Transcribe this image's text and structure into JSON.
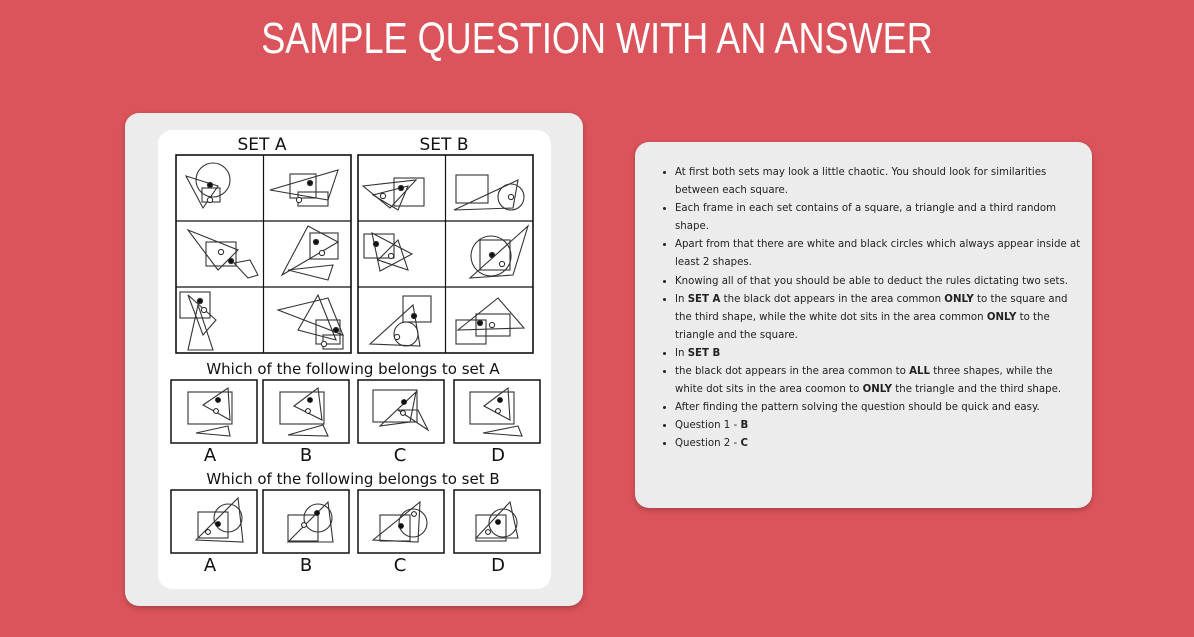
{
  "page": {
    "title": "SAMPLE QUESTION WITH AN ANSWER"
  },
  "figure": {
    "set_a_label": "SET A",
    "set_b_label": "SET B",
    "question_1": "Which of the following belongs to set A",
    "question_2": "Which of the following belongs to set B",
    "options_1": [
      "A",
      "B",
      "C",
      "D"
    ],
    "options_2": [
      "A",
      "B",
      "C",
      "D"
    ]
  },
  "answer": {
    "items": [
      [
        {
          "t": "At first both sets may look a little chaotic. You should look for similarities between each square."
        }
      ],
      [
        {
          "t": "Each frame in each set contains of a square, a triangle and a third random shape."
        }
      ],
      [
        {
          "t": "Apart from that there are white and black circles which always appear inside at least 2 shapes."
        }
      ],
      [
        {
          "t": "Knowing all of that you should be able to deduct the rules dictating two sets."
        }
      ],
      [
        {
          "t": "In "
        },
        {
          "t": "SET A",
          "b": true
        },
        {
          "t": " the black dot appears in the area common "
        },
        {
          "t": "ONLY",
          "b": true
        },
        {
          "t": " to the square and the third shape, while the white dot sits in the area common "
        },
        {
          "t": "ONLY",
          "b": true
        },
        {
          "t": " to the triangle and the square."
        }
      ],
      [
        {
          "t": "In "
        },
        {
          "t": "SET B",
          "b": true
        }
      ],
      [
        {
          "t": "the black dot appears in the area common to "
        },
        {
          "t": "ALL",
          "b": true
        },
        {
          "t": " three shapes, while the white dot sits in the area coomon to "
        },
        {
          "t": "ONLY",
          "b": true
        },
        {
          "t": " the triangle and the third shape."
        }
      ],
      [
        {
          "t": "After finding the pattern solving the question should be quick and easy."
        }
      ],
      [
        {
          "t": "Question 1 - "
        },
        {
          "t": "B",
          "b": true
        }
      ],
      [
        {
          "t": "Question 2 - "
        },
        {
          "t": "C",
          "b": true
        }
      ]
    ]
  }
}
